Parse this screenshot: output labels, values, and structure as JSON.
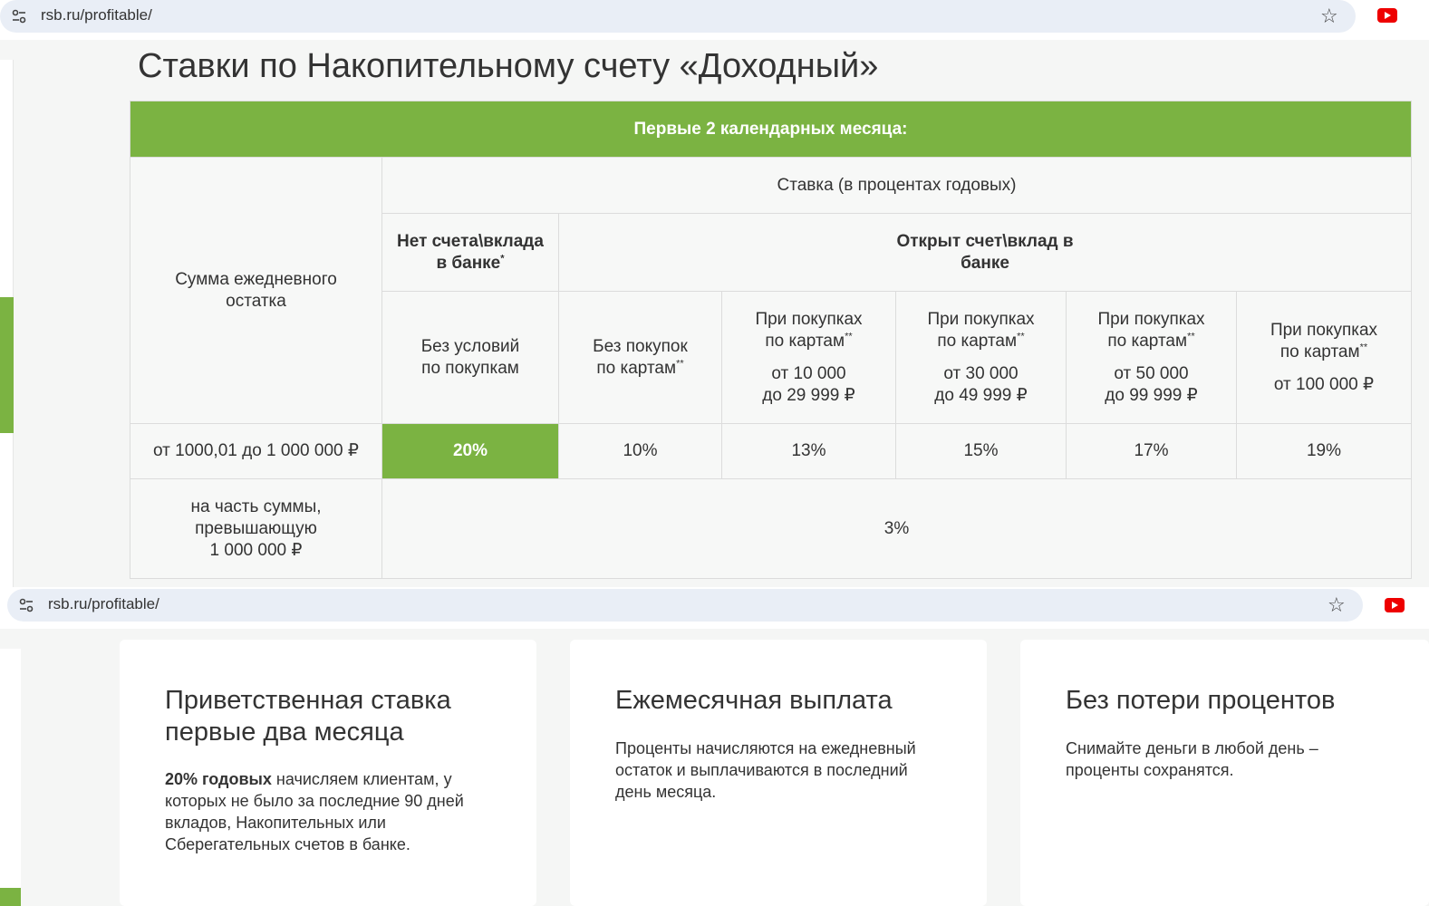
{
  "browser_top": {
    "url": "rsb.ru/profitable/"
  },
  "browser_bottom": {
    "url": "rsb.ru/profitable/"
  },
  "colors": {
    "accent_green": "#7bb342",
    "youtube_red": "#e00000"
  },
  "icons": [
    "tune-icon",
    "star-icon",
    "youtube-icon"
  ],
  "page": {
    "title": "Ставки по Накопительному счету «Доходный»"
  },
  "table": {
    "period_header": "Первые 2 календарных месяца:",
    "amount_header": "Сумма ежедневного остатка",
    "rate_header": "Ставка (в процентах годовых)",
    "no_account_header": "Нет счета\\вклада в банке",
    "no_account_mark": "*",
    "open_account_header": "Открыт счет\\вклад в банке",
    "columns": [
      {
        "line1": "Без условий",
        "line2": "по покупкам",
        "mark": "",
        "range1": "",
        "range2": ""
      },
      {
        "line1": "Без покупок",
        "line2": "по картам",
        "mark": "**",
        "range1": "",
        "range2": ""
      },
      {
        "line1": "При покупках",
        "line2": "по картам",
        "mark": "**",
        "range1": "от 10 000",
        "range2": "до 29 999 ₽"
      },
      {
        "line1": "При покупках",
        "line2": "по картам",
        "mark": "**",
        "range1": "от 30 000",
        "range2": "до 49 999 ₽"
      },
      {
        "line1": "При покупках",
        "line2": "по картам",
        "mark": "**",
        "range1": "от 50 000",
        "range2": "до 99 999 ₽"
      },
      {
        "line1": "При покупках",
        "line2": "по картам",
        "mark": "**",
        "range1": "от 100 000 ₽",
        "range2": ""
      }
    ],
    "rows": [
      {
        "label": "от 1000,01 до 1 000 000 ₽",
        "values": [
          "20%",
          "10%",
          "13%",
          "15%",
          "17%",
          "19%"
        ]
      },
      {
        "label_lines": [
          "на часть суммы,",
          "превышающую",
          "1 000 000 ₽"
        ],
        "value": "3%"
      }
    ]
  },
  "cards": [
    {
      "title": "Приветственная ставка первые два месяца",
      "text_bold": "20% годовых",
      "text": " начисляем клиентам, у которых не было за последние 90 дней вкладов, Накопительных или Сберегательных счетов в банке."
    },
    {
      "title": "Ежемесячная выплата",
      "text": "Проценты начисляются на ежедневный остаток и выплачиваются в последний день месяца."
    },
    {
      "title": "Без потери процентов",
      "text": "Снимайте деньги в любой день – проценты сохранятся."
    }
  ]
}
